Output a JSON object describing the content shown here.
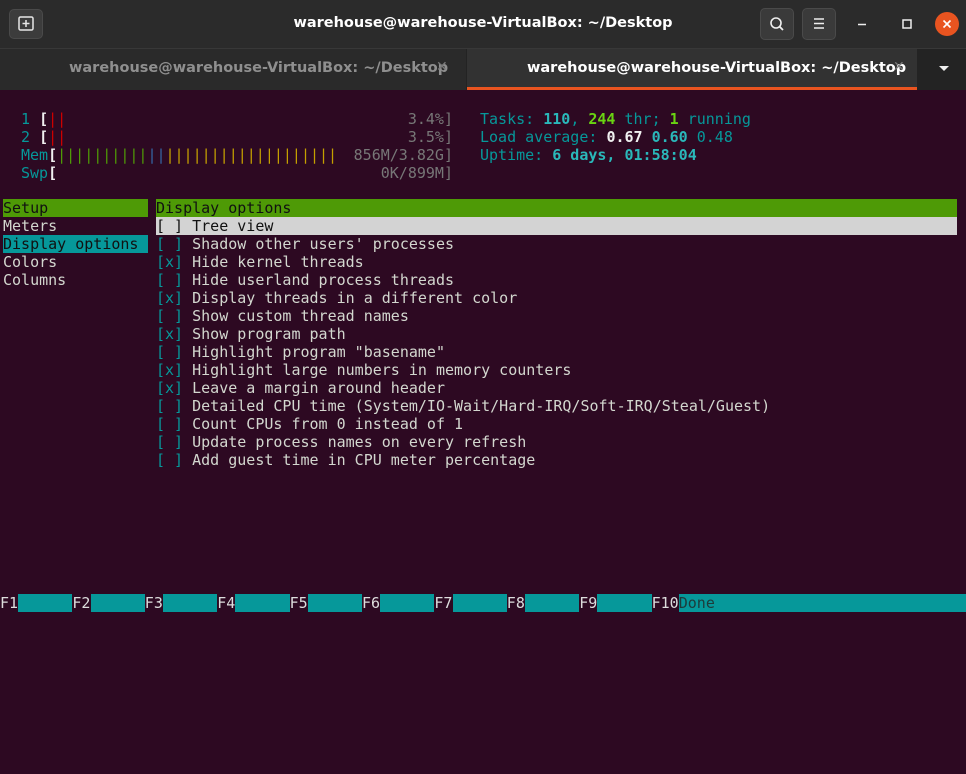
{
  "window": {
    "title": "warehouse@warehouse-VirtualBox: ~/Desktop",
    "accent": "#e95420"
  },
  "tabs": [
    {
      "label": "warehouse@warehouse-VirtualBox: ~/Desktop",
      "active": false
    },
    {
      "label": "warehouse@warehouse-VirtualBox: ~/Desktop",
      "active": true
    }
  ],
  "header": {
    "cpu1": {
      "id": "1",
      "bar": "||",
      "value": "3.4%]"
    },
    "cpu2": {
      "id": "2",
      "bar": "||",
      "value": "3.5%]"
    },
    "mem": {
      "label": "Mem",
      "bar": "|||||||||||||||||||||||||||||||",
      "value": "856M/3.82G]"
    },
    "swp": {
      "label": "Swp",
      "value": "0K/899M]"
    },
    "tasks_label": "Tasks: ",
    "tasks_count": "110",
    "threads_sep": ", ",
    "threads": "244",
    "thr_label": " thr; ",
    "running": "1",
    "running_label": " running",
    "load_label": "Load average: ",
    "load1": "0.67",
    "load5": "0.60",
    "load15": "0.48",
    "uptime_label": "Uptime: ",
    "uptime": "6 days, 01:58:04"
  },
  "setup": {
    "header": "Setup",
    "items": [
      "Meters",
      "Display options",
      "Colors",
      "Columns"
    ]
  },
  "panel": {
    "header": "Display options",
    "options": [
      {
        "check": "[ ]",
        "label": "Tree view"
      },
      {
        "check": "[ ]",
        "label": "Shadow other users' processes"
      },
      {
        "check": "[x]",
        "label": "Hide kernel threads"
      },
      {
        "check": "[ ]",
        "label": "Hide userland process threads"
      },
      {
        "check": "[x]",
        "label": "Display threads in a different color"
      },
      {
        "check": "[ ]",
        "label": "Show custom thread names"
      },
      {
        "check": "[x]",
        "label": "Show program path"
      },
      {
        "check": "[ ]",
        "label": "Highlight program \"basename\""
      },
      {
        "check": "[x]",
        "label": "Highlight large numbers in memory counters"
      },
      {
        "check": "[x]",
        "label": "Leave a margin around header"
      },
      {
        "check": "[ ]",
        "label": "Detailed CPU time (System/IO-Wait/Hard-IRQ/Soft-IRQ/Steal/Guest)"
      },
      {
        "check": "[ ]",
        "label": "Count CPUs from 0 instead of 1"
      },
      {
        "check": "[ ]",
        "label": "Update process names on every refresh"
      },
      {
        "check": "[ ]",
        "label": "Add guest time in CPU meter percentage"
      }
    ]
  },
  "fkeys": [
    {
      "key": "F1",
      "label": ""
    },
    {
      "key": "F2",
      "label": ""
    },
    {
      "key": "F3",
      "label": ""
    },
    {
      "key": "F4",
      "label": ""
    },
    {
      "key": "F5",
      "label": ""
    },
    {
      "key": "F6",
      "label": ""
    },
    {
      "key": "F7",
      "label": ""
    },
    {
      "key": "F8",
      "label": ""
    },
    {
      "key": "F9",
      "label": ""
    },
    {
      "key": "F10",
      "label": "Done"
    }
  ],
  "icons": {
    "new_tab": "new-tab-icon",
    "search": "search-icon",
    "menu": "hamburger-icon",
    "minimize": "minimize-icon",
    "maximize": "maximize-icon",
    "close": "close-icon",
    "tab_close": "tab-close-icon",
    "tab_dropdown": "chevron-down-icon"
  }
}
